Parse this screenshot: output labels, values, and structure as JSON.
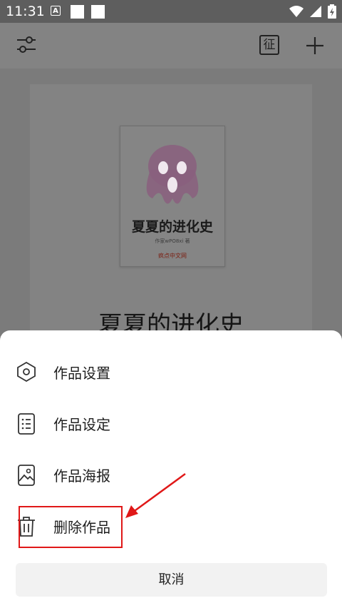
{
  "status_bar": {
    "time": "11:31",
    "notification_letter": "A"
  },
  "toolbar": {
    "filter_icon": "sliders-icon",
    "badge_label": "征",
    "add_icon": "plus-icon"
  },
  "book": {
    "cover_title": "夏夏的进化史",
    "cover_author": "作家wPO8xi 著",
    "cover_publisher": "疯点中文网",
    "title": "夏夏的进化史"
  },
  "menu": {
    "items": [
      {
        "label": "作品设置",
        "icon": "hexagon-settings-icon"
      },
      {
        "label": "作品设定",
        "icon": "list-document-icon"
      },
      {
        "label": "作品海报",
        "icon": "image-icon"
      },
      {
        "label": "删除作品",
        "icon": "trash-icon"
      }
    ],
    "cancel_label": "取消"
  },
  "colors": {
    "overlay": "#7b7b7b",
    "sheet": "#ffffff",
    "annotation": "#e01818"
  }
}
